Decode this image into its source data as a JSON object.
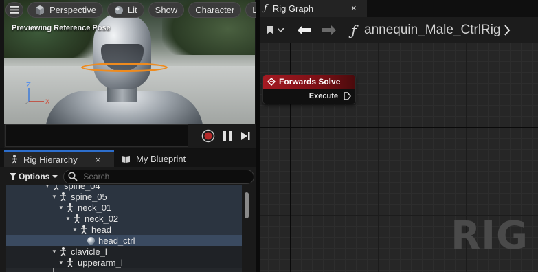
{
  "viewport": {
    "toolbar": {
      "perspective_label": "Perspective",
      "lit_label": "Lit",
      "show_label": "Show",
      "character_label": "Character",
      "lod_label": "LO"
    },
    "preview_label": "Previewing Reference Pose",
    "axis": {
      "z": "Z",
      "x": "X"
    },
    "control_colors": {
      "ring": "#ef8b1e"
    }
  },
  "hierarchy": {
    "tabs": [
      {
        "label": "Rig Hierarchy",
        "close": "×"
      },
      {
        "label": "My Blueprint"
      }
    ],
    "options_label": "Options",
    "search_placeholder": "Search",
    "items": [
      {
        "label": "spine_04",
        "icon": "bone-icon"
      },
      {
        "label": "spine_05",
        "icon": "bone-icon"
      },
      {
        "label": "neck_01",
        "icon": "bone-icon"
      },
      {
        "label": "neck_02",
        "icon": "bone-icon"
      },
      {
        "label": "head",
        "icon": "bone-icon"
      },
      {
        "label": "head_ctrl",
        "icon": "control-sphere-icon",
        "selected": true
      },
      {
        "label": "clavicle_l",
        "icon": "bone-icon"
      },
      {
        "label": "upperarm_l",
        "icon": "bone-icon"
      }
    ]
  },
  "graph": {
    "tab_title": "Rig Graph",
    "tab_close": "×",
    "breadcrumb": "annequin_Male_CtrlRig",
    "node": {
      "title": "Forwards Solve",
      "pin_label": "Execute",
      "header_color": "#a51a22"
    },
    "watermark": "RIG"
  }
}
